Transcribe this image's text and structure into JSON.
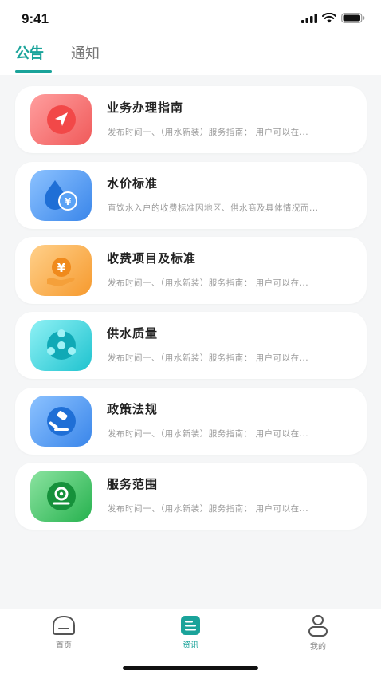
{
  "status_bar": {
    "time": "9:41"
  },
  "tabs": [
    {
      "label": "公告",
      "active": true
    },
    {
      "label": "通知",
      "active": false
    }
  ],
  "cards": [
    {
      "title": "业务办理指南",
      "desc": "发布时间一、（用水新装）服务指南：  用户可以在...",
      "icon": "navigation-arrow-icon",
      "color": "#f56b6b"
    },
    {
      "title": "水价标准",
      "desc": "直饮水入户的收费标准因地区、供水商及具体情况而...",
      "icon": "water-drop-yuan-icon",
      "color": "#3e8ef0"
    },
    {
      "title": "收费项目及标准",
      "desc": "发布时间一、（用水新装）服务指南：  用户可以在...",
      "icon": "yuan-coin-hand-icon",
      "color": "#f7a43c"
    },
    {
      "title": "供水质量",
      "desc": "发布时间一、（用水新装）服务指南：  用户可以在...",
      "icon": "water-quality-icon",
      "color": "#25c6d3"
    },
    {
      "title": "政策法规",
      "desc": "发布时间一、（用水新装）服务指南：  用户可以在...",
      "icon": "gavel-icon",
      "color": "#3e8ef0"
    },
    {
      "title": "服务范围",
      "desc": "发布时间一、（用水新装）服务指南：  用户可以在...",
      "icon": "location-pin-icon",
      "color": "#2fb85a"
    }
  ],
  "bottom_nav": [
    {
      "label": "首页",
      "icon": "home-icon",
      "active": false
    },
    {
      "label": "资讯",
      "icon": "news-icon",
      "active": true
    },
    {
      "label": "我的",
      "icon": "profile-icon",
      "active": false
    }
  ],
  "accent_color": "#1aa39a"
}
